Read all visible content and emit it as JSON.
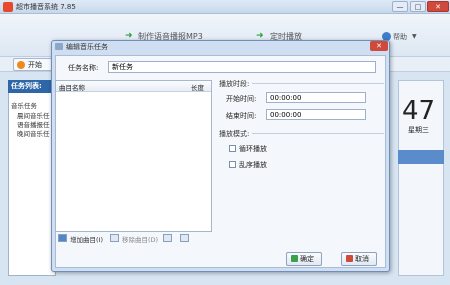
{
  "main": {
    "title": "超市播音系统 7.85",
    "window_minimize": "—",
    "window_maximize": "□",
    "window_close": "✕",
    "menu": {
      "make_voice_label": "制作语音播报MP3",
      "schedule_label": "定时播放",
      "help_label": "帮助",
      "help_arrow": "▼"
    },
    "play_button_label": "开始",
    "left_panel": {
      "header": "任务列表:",
      "group": "音乐任务",
      "items": [
        "晨间音乐任",
        "语音播报任",
        "晚间音乐任"
      ]
    },
    "right_panel": {
      "big_number": "47",
      "weekday": "星期三"
    }
  },
  "dialog": {
    "title": "编辑音乐任务",
    "close_label": "✕",
    "name_label": "任务名称:",
    "name_value": "新任务",
    "tracks": {
      "col_name": "曲目名称",
      "col_length": "长度",
      "add_label": "增加曲目(I)",
      "remove_label": "移除曲目(D)"
    },
    "time_section": "播放时段:",
    "start_label": "开始时间:",
    "start_value": "00:00:00",
    "end_label": "结束时间:",
    "end_value": "00:00:00",
    "mode_section": "播放模式:",
    "loop_label": "循环播放",
    "shuffle_label": "乱序播放",
    "ok_label": "确定",
    "cancel_label": "取消"
  },
  "colors": {
    "accent_blue": "#2e66a8",
    "close_red": "#cf4a3a",
    "ok_green": "#3aa34a"
  }
}
